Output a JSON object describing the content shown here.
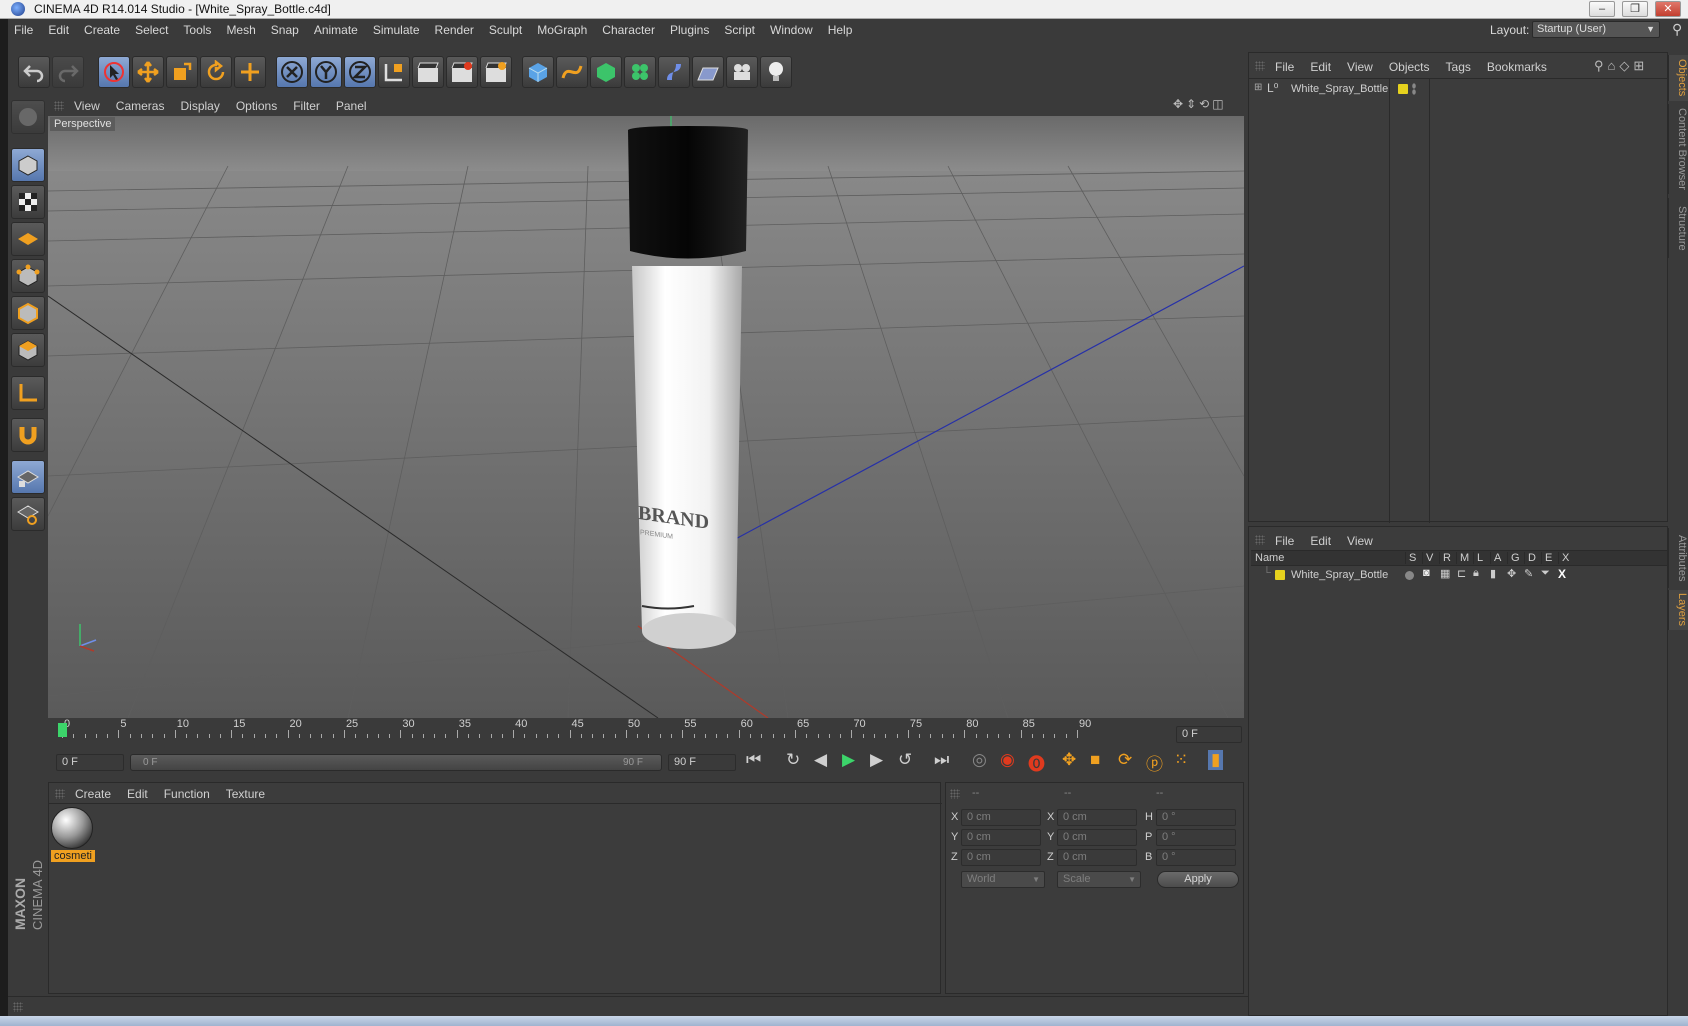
{
  "window": {
    "title": "CINEMA 4D R14.014 Studio - [White_Spray_Bottle.c4d]",
    "min": "–",
    "max": "❐",
    "close": "✕"
  },
  "menubar": {
    "items": [
      "File",
      "Edit",
      "Create",
      "Select",
      "Tools",
      "Mesh",
      "Snap",
      "Animate",
      "Simulate",
      "Render",
      "Sculpt",
      "MoGraph",
      "Character",
      "Plugins",
      "Script",
      "Window",
      "Help"
    ],
    "layout_label": "Layout:",
    "layout_value": "Startup (User)"
  },
  "viewport": {
    "menu": [
      "View",
      "Cameras",
      "Display",
      "Options",
      "Filter",
      "Panel"
    ],
    "label": "Perspective",
    "bottle_text_1": "BRAND",
    "bottle_text_2": "PREMIUM"
  },
  "timeline": {
    "ticks": [
      "0",
      "5",
      "10",
      "15",
      "20",
      "25",
      "30",
      "35",
      "40",
      "45",
      "50",
      "55",
      "60",
      "65",
      "70",
      "75",
      "80",
      "85",
      "90"
    ],
    "current_frame": "0 F",
    "start_field": "0 F",
    "range_start": "0 F",
    "range_end": "90 F",
    "end_field": "90 F"
  },
  "materials": {
    "menu": [
      "Create",
      "Edit",
      "Function",
      "Texture"
    ],
    "material_name": "cosmeti"
  },
  "coords": {
    "headers": [
      "--",
      "--",
      "--"
    ],
    "rows": [
      {
        "a": "X",
        "av": "0 cm",
        "b": "X",
        "bv": "0 cm",
        "c": "H",
        "cv": "0 °"
      },
      {
        "a": "Y",
        "av": "0 cm",
        "b": "Y",
        "bv": "0 cm",
        "c": "P",
        "cv": "0 °"
      },
      {
        "a": "Z",
        "av": "0 cm",
        "b": "Z",
        "bv": "0 cm",
        "c": "B",
        "cv": "0 °"
      }
    ],
    "world": "World",
    "scale": "Scale",
    "apply": "Apply"
  },
  "objects": {
    "menu": [
      "File",
      "Edit",
      "View",
      "Objects",
      "Tags",
      "Bookmarks"
    ],
    "item": "White_Spray_Bottle"
  },
  "layers": {
    "menu": [
      "File",
      "Edit",
      "View"
    ],
    "col_name": "Name",
    "cols": [
      "S",
      "V",
      "R",
      "M",
      "L",
      "A",
      "G",
      "D",
      "E",
      "X"
    ],
    "item": "White_Spray_Bottle"
  },
  "side_tabs": {
    "objects": "Objects",
    "content_browser": "Content Browser",
    "structure": "Structure",
    "attributes": "Attributes",
    "layers": "Layers"
  },
  "brand": {
    "maxon": "MAXON",
    "c4d": "CINEMA 4D"
  },
  "colors": {
    "accent": "#f0a020",
    "selection_blue": "#5677ae",
    "object_yellow": "#e6d21e"
  }
}
